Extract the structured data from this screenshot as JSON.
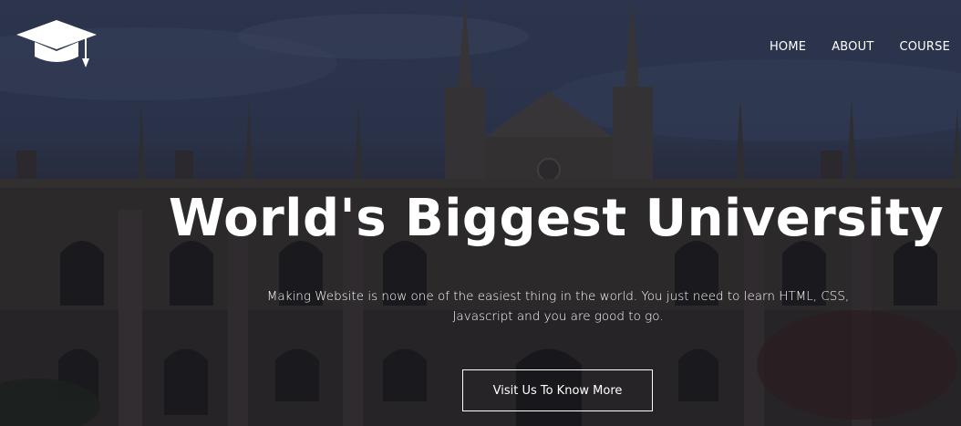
{
  "header": {
    "logo_icon": "graduation-cap-icon",
    "nav": [
      {
        "label": "HOME"
      },
      {
        "label": "ABOUT"
      },
      {
        "label": "COURSE"
      }
    ]
  },
  "hero": {
    "title": "World's Biggest University",
    "subtitle": "Making Website is now one of the easiest thing in the world. You just need to learn HTML, CSS, Javascript and you are good to go.",
    "cta_label": "Visit Us To Know More",
    "background_image": "university-building-photo"
  },
  "colors": {
    "text": "#ffffff",
    "overlay": "#0a0c1e"
  }
}
